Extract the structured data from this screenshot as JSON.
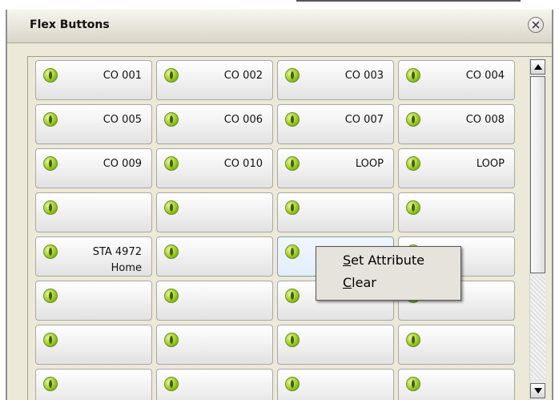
{
  "window": {
    "title": "Flex Buttons"
  },
  "grid": {
    "rows": [
      [
        "CO 001",
        "CO 002",
        "CO 003",
        "CO 004"
      ],
      [
        "CO 005",
        "CO 006",
        "CO 007",
        "CO 008"
      ],
      [
        "CO 009",
        "CO 010",
        "LOOP",
        "LOOP"
      ],
      [
        "",
        "",
        "",
        ""
      ],
      [
        "STA 4972\nHome",
        "",
        "",
        ""
      ],
      [
        "",
        "",
        "",
        ""
      ],
      [
        "",
        "",
        "",
        ""
      ],
      [
        "",
        "",
        "",
        ""
      ]
    ],
    "highlighted": {
      "row": 4,
      "col": 2
    }
  },
  "context_menu": {
    "items": [
      {
        "label": "Set Attribute",
        "accel": "S",
        "rest": "et Attribute"
      },
      {
        "label": "Clear",
        "accel": "C",
        "rest": "lear"
      }
    ]
  },
  "icons": {
    "button_indicator": "green-led-icon",
    "close": "close-icon"
  },
  "colors": {
    "led_green": "#9ccb23",
    "button_border": "#a8a8a8",
    "highlight": "#e3eefb"
  }
}
